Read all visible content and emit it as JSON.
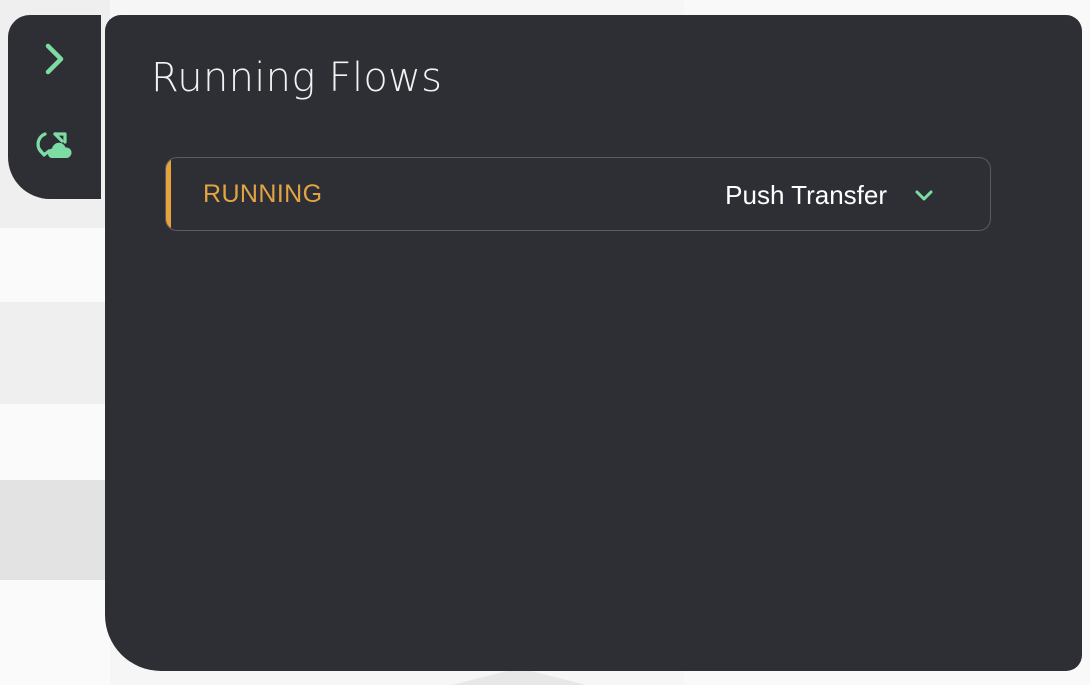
{
  "sidebar": {
    "expand_icon": "chevron-right-icon",
    "flows_icon": "cloud-sync-icon",
    "accent_color": "#7ddca4"
  },
  "panel": {
    "title": "Running Flows",
    "flows": [
      {
        "status": "RUNNING",
        "name": "Push Transfer",
        "status_color": "#e6a33c",
        "expand_icon": "chevron-down-icon"
      }
    ]
  }
}
